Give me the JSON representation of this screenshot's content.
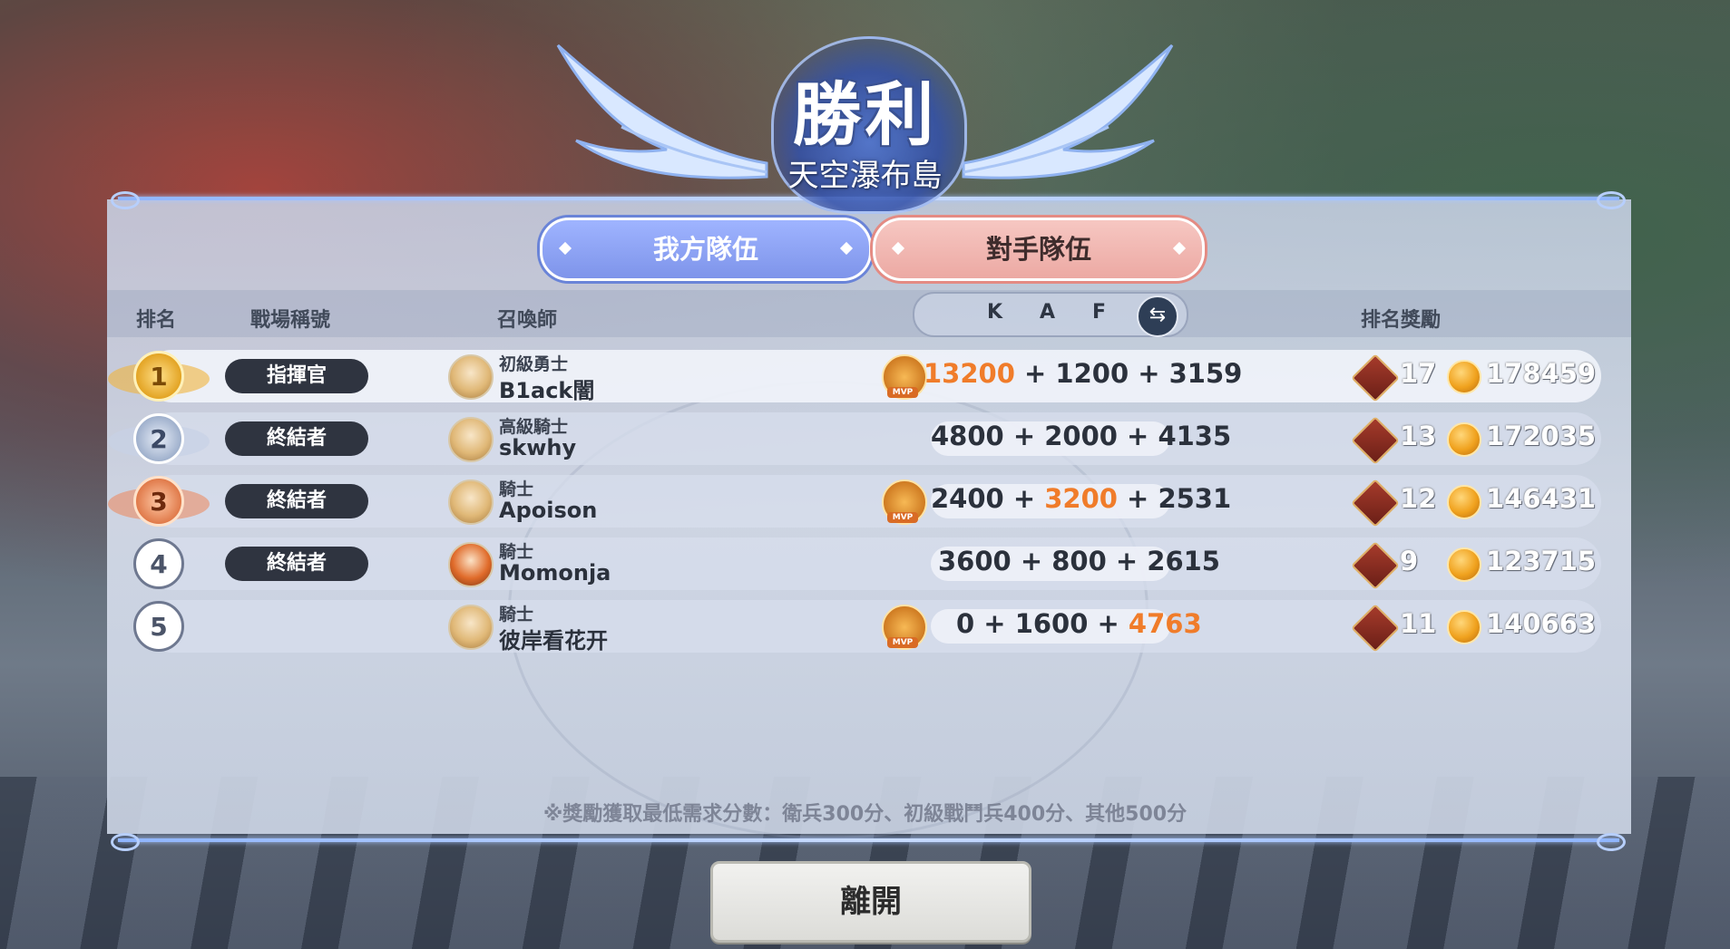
{
  "screen": {
    "title": "勝利",
    "map_name": "天空瀑布島"
  },
  "tabs": [
    {
      "label": "我方隊伍",
      "active": true
    },
    {
      "label": "對手隊伍",
      "active": false
    }
  ],
  "headers": {
    "rank": "排名",
    "battle_title": "戰場稱號",
    "summoner": "召喚師",
    "k": "K",
    "a": "A",
    "f": "F",
    "reward": "排名獎勵"
  },
  "players": [
    {
      "rank": "1",
      "battle_title": "指揮官",
      "class": "初級勇士",
      "name": "B1ack闇",
      "k": "13200",
      "a": "1200",
      "f": "3159",
      "highlight": "k",
      "mvp": true,
      "tickets": "17",
      "coins": "178459"
    },
    {
      "rank": "2",
      "battle_title": "終結者",
      "class": "高級騎士",
      "name": "skwhy",
      "k": "4800",
      "a": "2000",
      "f": "4135",
      "highlight": "",
      "mvp": false,
      "tickets": "13",
      "coins": "172035"
    },
    {
      "rank": "3",
      "battle_title": "終結者",
      "class": "騎士",
      "name": "Apoison",
      "k": "2400",
      "a": "3200",
      "f": "2531",
      "highlight": "a",
      "mvp": true,
      "tickets": "12",
      "coins": "146431"
    },
    {
      "rank": "4",
      "battle_title": "終結者",
      "class": "騎士",
      "name": "Momonja",
      "k": "3600",
      "a": "800",
      "f": "2615",
      "highlight": "",
      "mvp": false,
      "tickets": "9",
      "coins": "123715"
    },
    {
      "rank": "5",
      "battle_title": "",
      "class": "騎士",
      "name": "彼岸看花开",
      "k": "0",
      "a": "1600",
      "f": "4763",
      "highlight": "f",
      "mvp": true,
      "tickets": "11",
      "coins": "140663"
    }
  ],
  "mvp_tag": "MVP",
  "footnote": "※獎勵獲取最低需求分數：衛兵300分、初級戰鬥兵400分、其他500分",
  "leave_button": "離開",
  "colors": {
    "highlight": "#f07c2a",
    "own_tab": "#8ea3f5",
    "opp_tab": "#efb4ae",
    "title_pill": "#2f3440"
  }
}
